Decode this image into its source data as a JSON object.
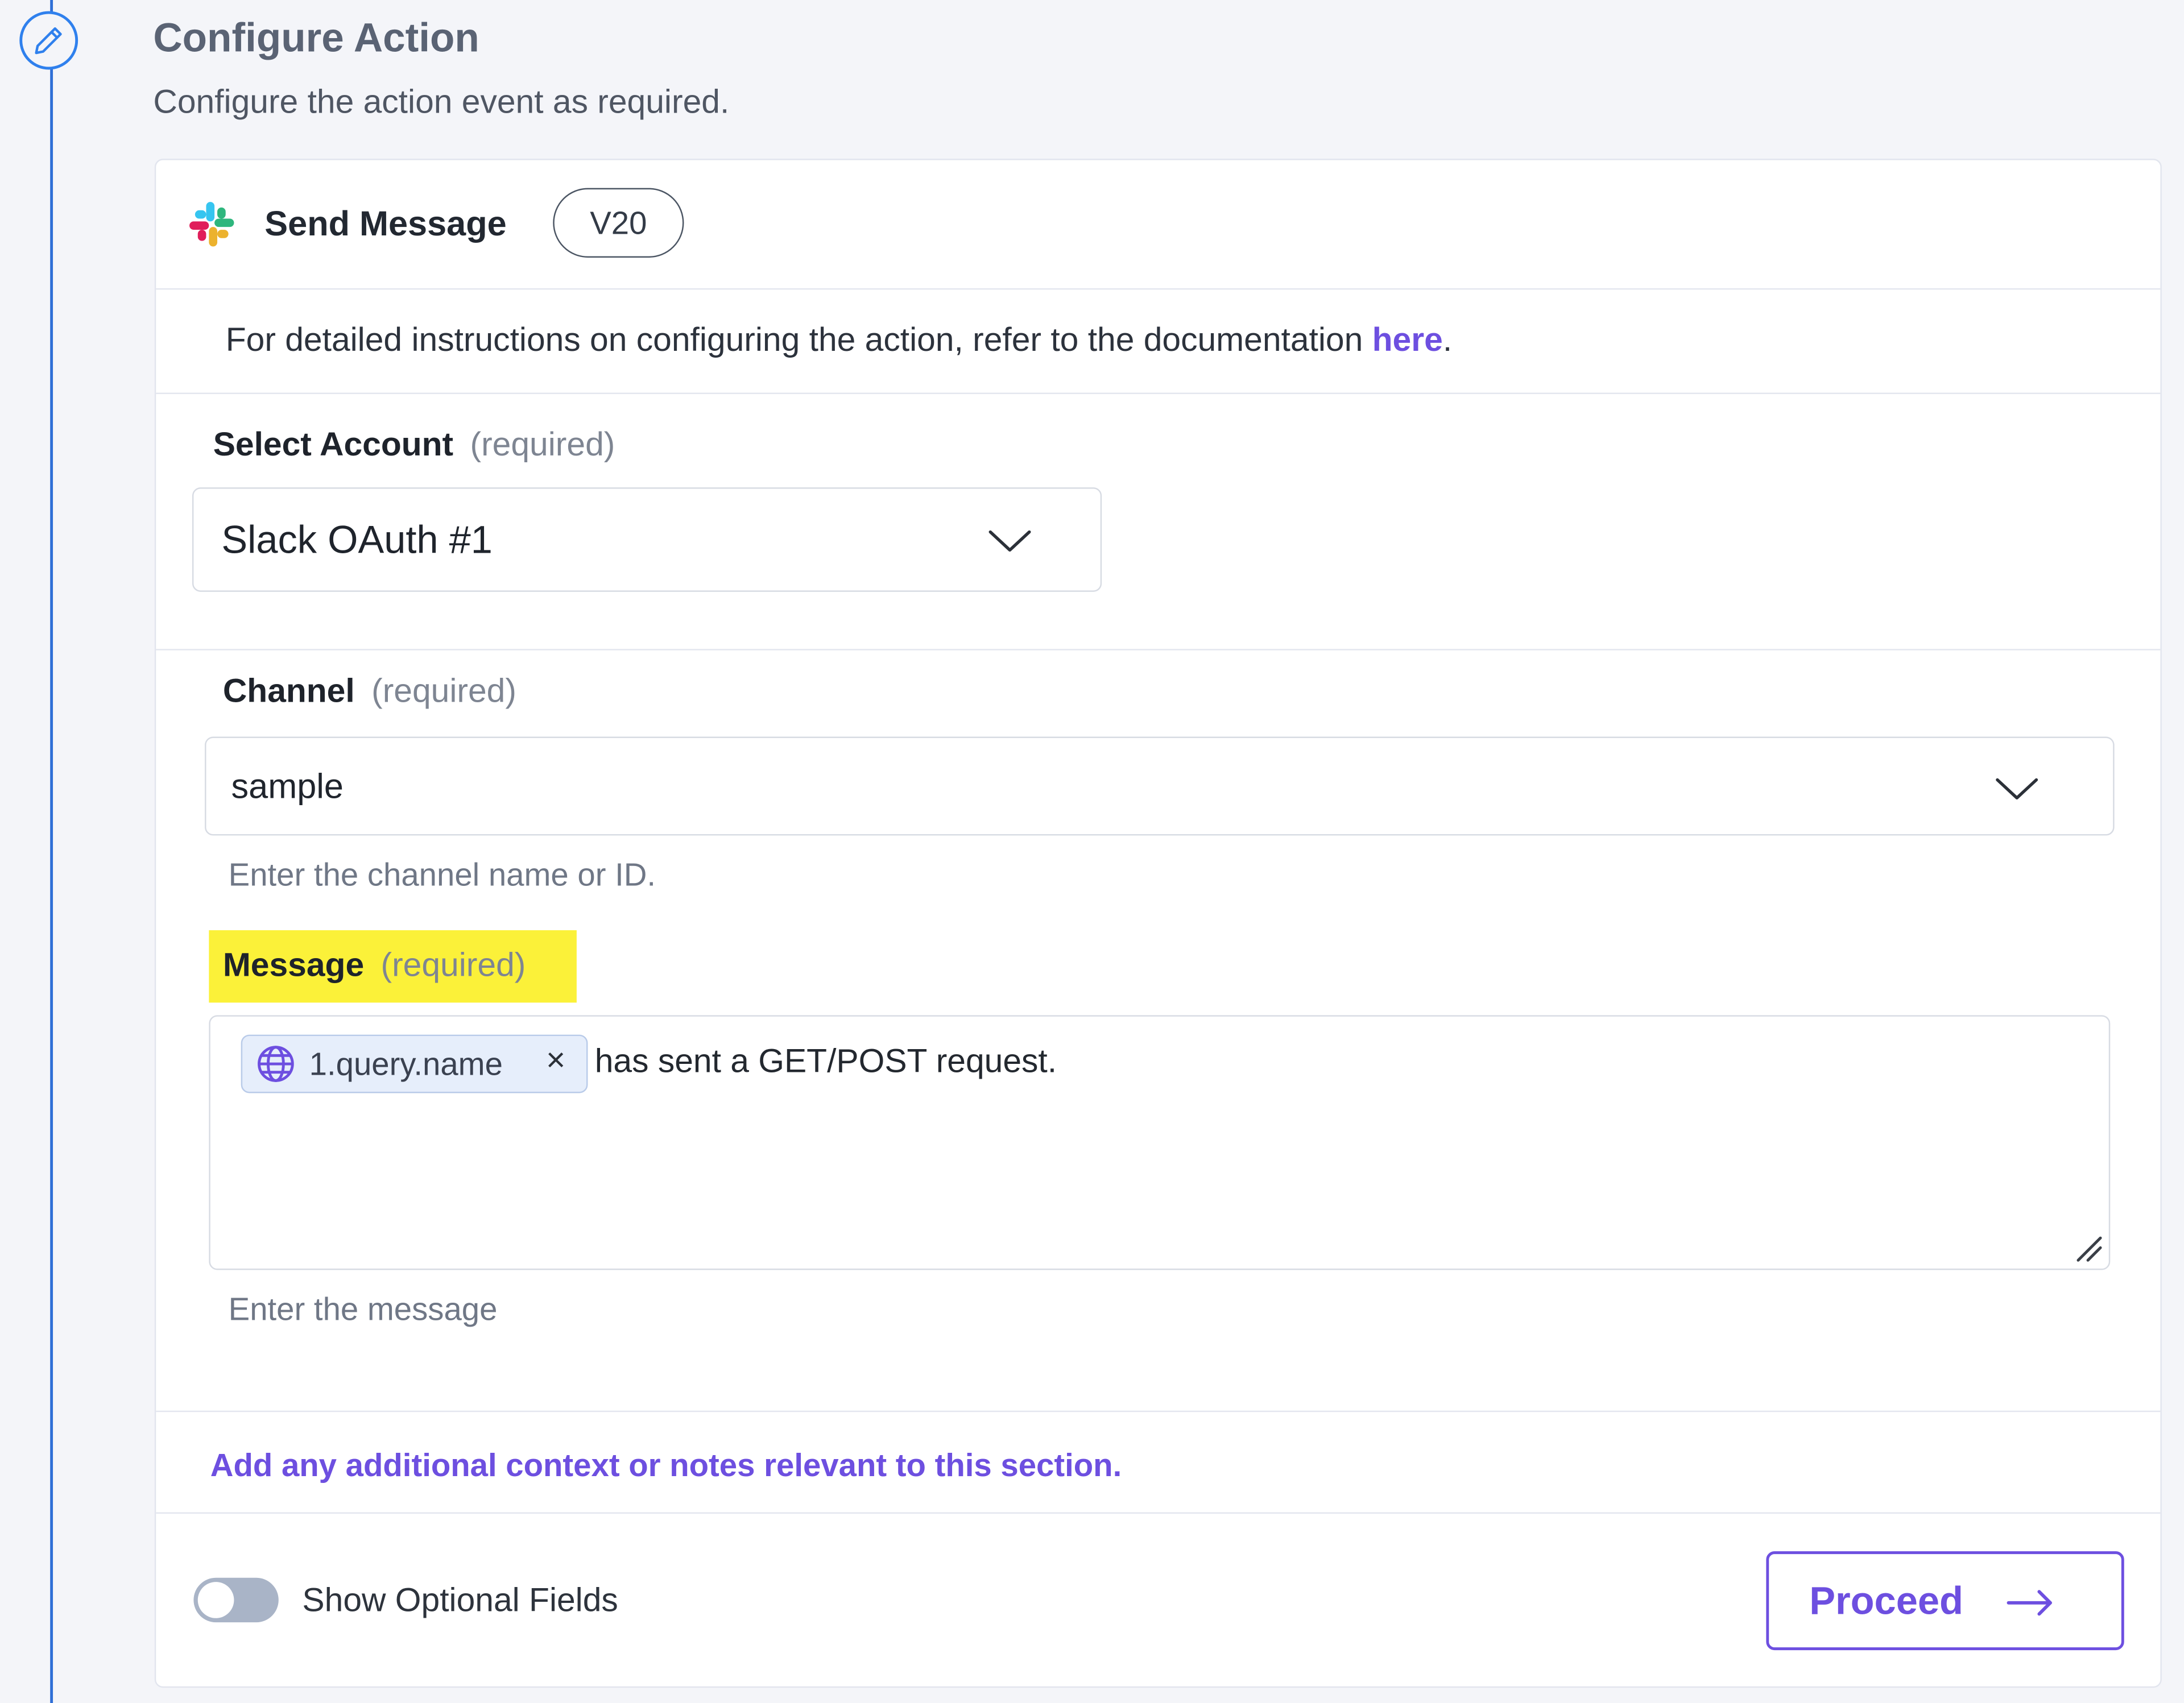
{
  "section": {
    "title": "Configure Action",
    "subtitle": "Configure the action event as required."
  },
  "action": {
    "name": "Send Message",
    "version": "V20",
    "app_icon": "slack-icon"
  },
  "documentation": {
    "text": "For detailed instructions on configuring the action, refer to the documentation ",
    "link_label": "here",
    "suffix": "."
  },
  "fields": {
    "account": {
      "label": "Select Account",
      "required": "(required)",
      "value": "Slack OAuth #1"
    },
    "channel": {
      "label": "Channel",
      "required": "(required)",
      "value": "sample",
      "help": "Enter the channel name or ID."
    },
    "message": {
      "label": "Message",
      "required": "(required)",
      "token_label": "1.query.name",
      "token_icon": "globe-icon",
      "text": "has sent a GET/POST request.",
      "help": "Enter the message"
    }
  },
  "notes_link": "Add any additional context or notes relevant to this section.",
  "footer": {
    "optional_fields_label": "Show Optional Fields",
    "optional_fields_on": false,
    "proceed_label": "Proceed"
  },
  "colors": {
    "accent": "#6d4fe0",
    "rail": "#2f6fd6",
    "highlight": "#fbf139"
  }
}
